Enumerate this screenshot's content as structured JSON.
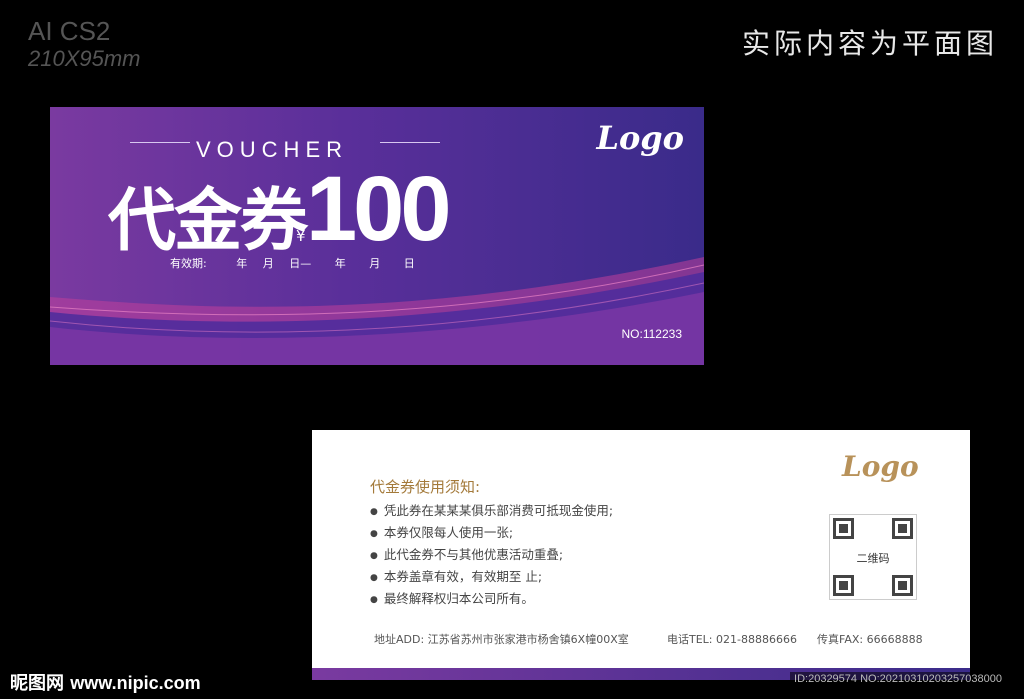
{
  "top_left": {
    "line1": "AI CS2",
    "line2": "210X95mm"
  },
  "top_right": "实际内容为平面图",
  "front": {
    "voucher_word": "VOUCHER",
    "title_cn": "代金券",
    "currency": "¥",
    "amount": "100",
    "validity_label": "有效期:",
    "validity_units": [
      "年",
      "月",
      "日—",
      "年",
      "月",
      "日"
    ],
    "logo": "Logo",
    "number": "NO:112233",
    "colors": {
      "start": "#7a3aa0",
      "end": "#3a2b8a",
      "accent": "#c0409a"
    }
  },
  "back": {
    "logo": "Logo",
    "notice_title": "代金券使用须知:",
    "notices": [
      "凭此券在某某某俱乐部消费可抵现金使用;",
      "本券仅限每人使用一张;",
      "此代金券不与其他优惠活动重叠;",
      "本券盖章有效，有效期至         止;",
      "最终解释权归本公司所有。"
    ],
    "qr_label": "二维码",
    "address": "地址ADD:  江苏省苏州市张家港市杨舍镇6X幢00X室",
    "tel": "电话TEL: 021-88886666",
    "fax": "传真FAX: 66668888",
    "colors": {
      "gold": "#a47a3a"
    }
  },
  "watermark": {
    "left_cn": "昵图网",
    "left_site": "www.nipic.com",
    "right": "ID:20329574 NO:20210310203257038000"
  }
}
